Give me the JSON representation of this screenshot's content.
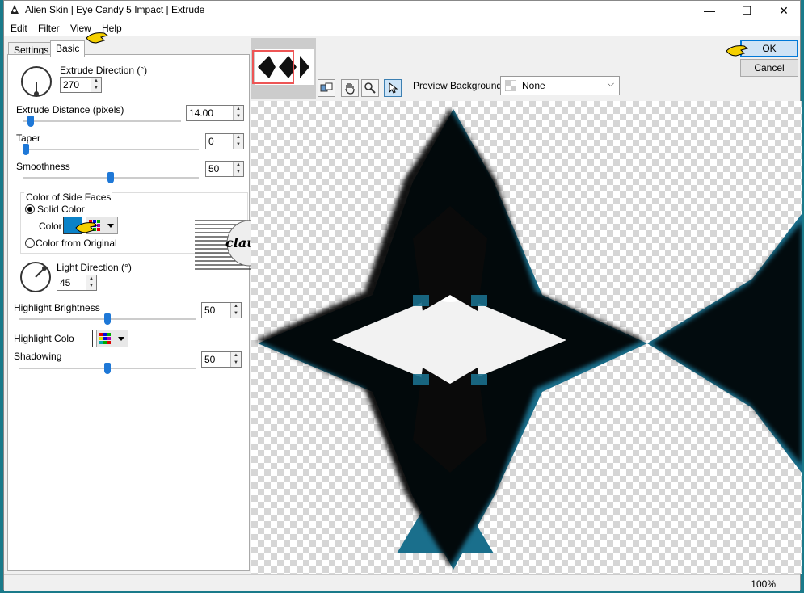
{
  "window": {
    "title": "Alien Skin | Eye Candy 5 Impact | Extrude",
    "minimize_glyph": "—",
    "maximize_glyph": "☐",
    "close_glyph": "✕"
  },
  "menu": {
    "items": [
      "Edit",
      "Filter",
      "View",
      "Help"
    ]
  },
  "tabs": {
    "settings": "Settings",
    "basic": "Basic"
  },
  "controls": {
    "extrude_direction_label": "Extrude Direction (°)",
    "extrude_direction_value": "270",
    "extrude_distance_label": "Extrude Distance (pixels)",
    "extrude_distance_value": "14.00",
    "extrude_distance_level": 0.05,
    "taper_label": "Taper",
    "taper_value": "0",
    "taper_level": 0.0,
    "smoothness_label": "Smoothness",
    "smoothness_value": "50",
    "smoothness_level": 0.5,
    "side_faces_group_label": "Color of Side Faces",
    "solid_color_label": "Solid Color",
    "color_label": "Color",
    "color_from_original_label": "Color from Original",
    "light_direction_label": "Light Direction (°)",
    "light_direction_value": "45",
    "highlight_brightness_label": "Highlight Brightness",
    "highlight_brightness_value": "50",
    "highlight_brightness_level": 0.5,
    "highlight_color_label": "Highlight Color",
    "shadowing_label": "Shadowing",
    "shadowing_value": "50",
    "shadowing_level": 0.5
  },
  "colors": {
    "side_face": "#0a82c8",
    "highlight": "#ffffff",
    "preview_teal": "#1a6f8c",
    "accent": "#1e78d7"
  },
  "preview_toolbar": {
    "preview_background_label": "Preview Background:",
    "preview_background_value": "None"
  },
  "buttons": {
    "ok": "OK",
    "cancel": "Cancel"
  },
  "watermark_text": "claudia",
  "status": {
    "zoom": "100%"
  }
}
